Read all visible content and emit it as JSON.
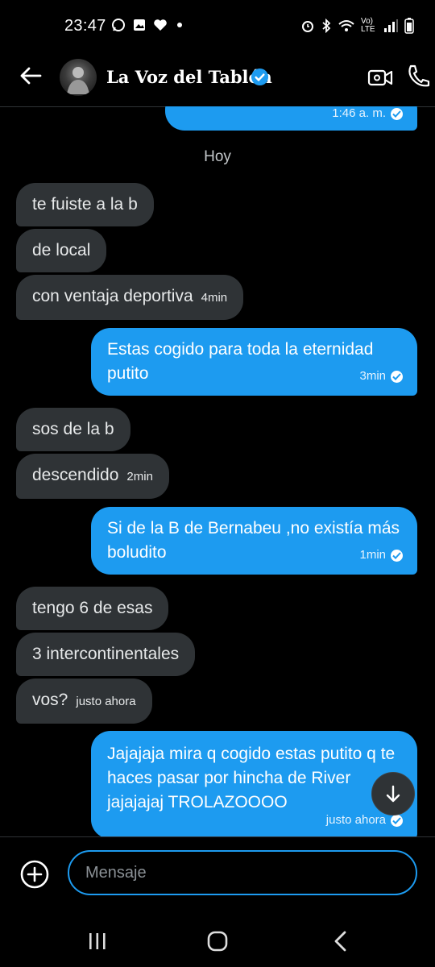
{
  "status_bar": {
    "time": "23:47",
    "network": "Vo) LTE",
    "icons_left": [
      "whatsapp-icon",
      "gallery-icon",
      "heart-icon",
      "notification-dot"
    ],
    "icons_right": [
      "alarm-icon",
      "bluetooth-icon",
      "wifi-icon",
      "signal-icon",
      "battery-icon"
    ]
  },
  "header": {
    "title": "La Voz del Tablón",
    "verified": true
  },
  "chat": {
    "previous_time": "1:46 a. m.",
    "day_label": "Hoy",
    "messages": [
      {
        "dir": "in",
        "text": "te fuiste a la b",
        "time": ""
      },
      {
        "dir": "in",
        "text": "de local",
        "time": ""
      },
      {
        "dir": "in",
        "text": "con ventaja deportiva",
        "time": "4min"
      },
      {
        "dir": "out",
        "text": "Estas cogido para toda la eternidad putito",
        "time": "3min"
      },
      {
        "dir": "in",
        "text": "sos de la b",
        "time": ""
      },
      {
        "dir": "in",
        "text": "descendido",
        "time": "2min"
      },
      {
        "dir": "out",
        "text": "Si de la B de Bernabeu ,no existía más boludito",
        "time": "1min"
      },
      {
        "dir": "in",
        "text": "tengo 6 de esas",
        "time": ""
      },
      {
        "dir": "in",
        "text": "3 intercontinentales",
        "time": ""
      },
      {
        "dir": "in",
        "text": "vos?",
        "time": "justo ahora"
      },
      {
        "dir": "out",
        "text": "Jajajaja mira q cogido estas putito q te haces pasar por hincha de River jajajajaj TROLAZOOOO",
        "time": "justo ahora"
      }
    ]
  },
  "composer": {
    "placeholder": "Mensaje"
  },
  "colors": {
    "accent": "#1d9bf0",
    "incoming_bubble": "#2f3336",
    "background": "#000000"
  }
}
